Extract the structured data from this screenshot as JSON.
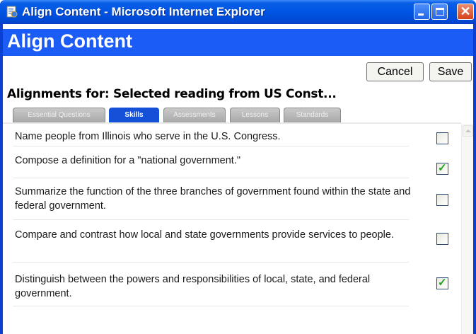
{
  "window": {
    "title": "Align Content - Microsoft Internet Explorer"
  },
  "page": {
    "title": "Align Content",
    "cancel_label": "Cancel",
    "save_label": "Save",
    "alignments_heading": "Alignments for: Selected reading from US Const..."
  },
  "tabs": [
    {
      "label": "Essential Questions",
      "active": false
    },
    {
      "label": "Skills",
      "active": true
    },
    {
      "label": "Assessments",
      "active": false
    },
    {
      "label": "Lessons",
      "active": false
    },
    {
      "label": "Standards",
      "active": false
    }
  ],
  "skills": [
    {
      "text": "Name people from Illinois who serve in the U.S. Congress.",
      "checked": false
    },
    {
      "text": "Compose a definition for a \"national government.\"",
      "checked": true
    },
    {
      "text": "Summarize the function of the three branches of government found within the state and federal government.",
      "checked": false
    },
    {
      "text": "Compare and contrast how local and state governments provide services to people.",
      "checked": false
    },
    {
      "text": "Distinguish between the powers and responsibilities of local, state, and federal government.",
      "checked": true
    }
  ],
  "colors": {
    "header": "#1a5cf5",
    "active_tab": "#1550d8",
    "check": "#21a121"
  },
  "icons": {
    "window_icon": "ie-page-icon",
    "minimize": "minimize-icon",
    "maximize": "maximize-icon",
    "close": "close-icon",
    "scroll_up": "scroll-up-arrow-icon"
  }
}
